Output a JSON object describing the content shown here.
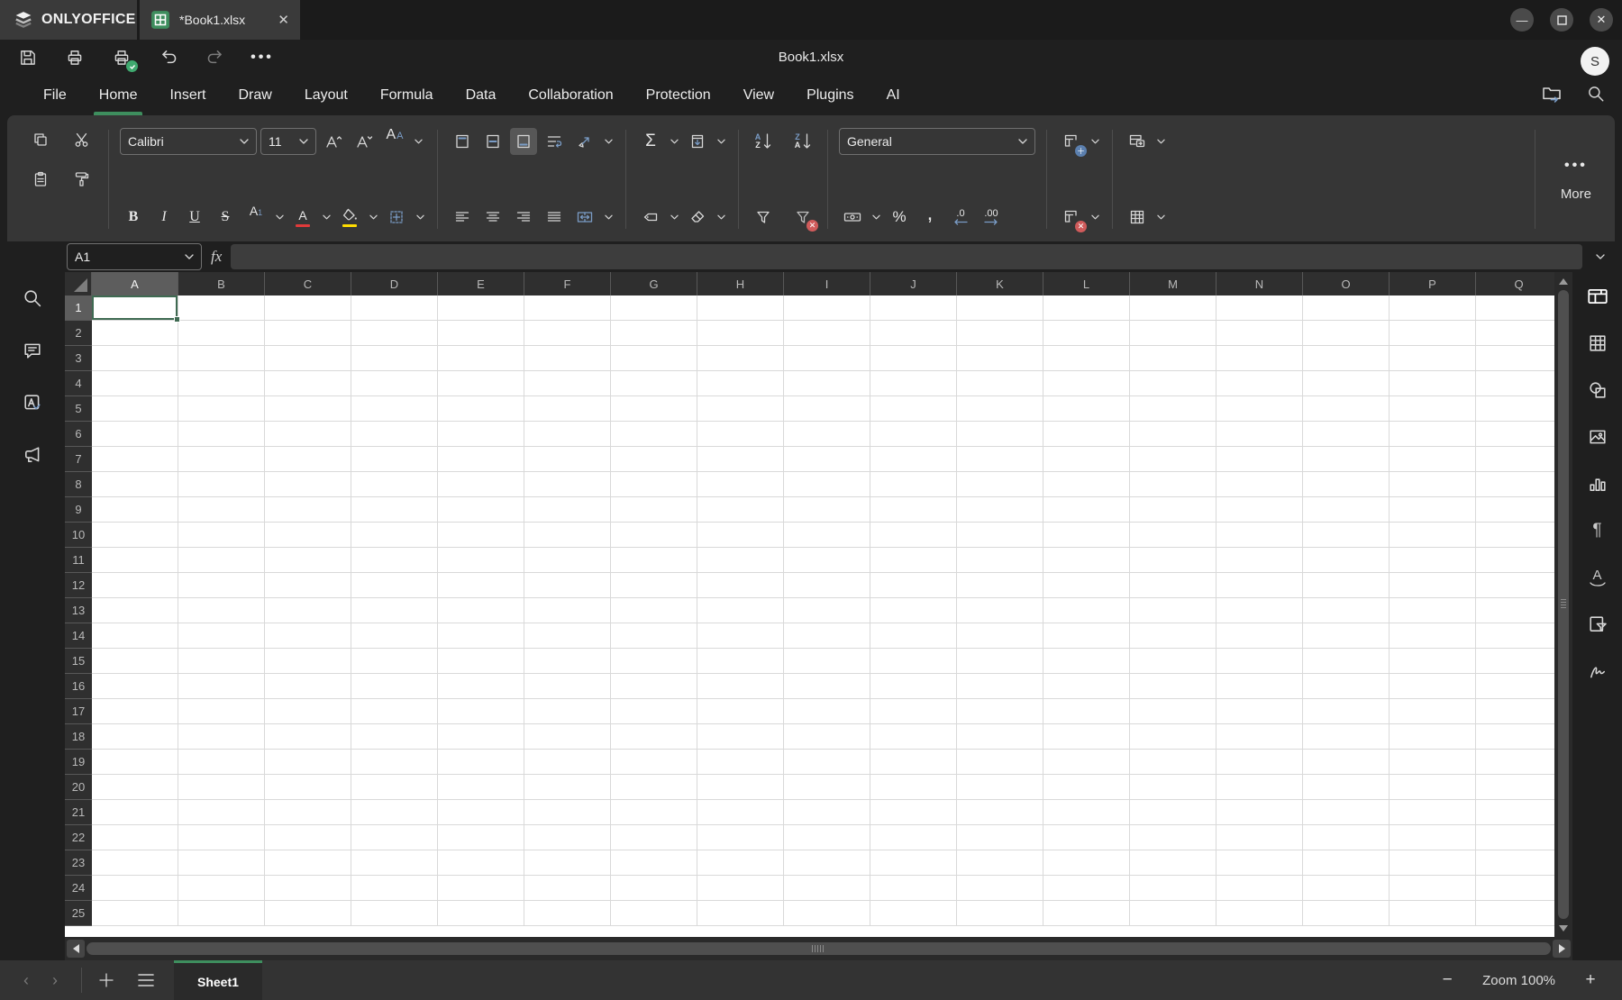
{
  "titlebar": {
    "brand": "ONLYOFFICE",
    "doc_tab_title": "*Book1.xlsx"
  },
  "header": {
    "doc_title": "Book1.xlsx",
    "user_initial": "S"
  },
  "menu": {
    "tabs": [
      "File",
      "Home",
      "Insert",
      "Draw",
      "Layout",
      "Formula",
      "Data",
      "Collaboration",
      "Protection",
      "View",
      "Plugins",
      "AI"
    ],
    "active_tab": "Home"
  },
  "toolbar": {
    "font_name": "Calibri",
    "font_size": "11",
    "number_format": "General",
    "more_label": "More",
    "glyphs": {
      "bold": "B",
      "italic": "I",
      "underline": "U",
      "strikethrough": "S",
      "sum": "Σ",
      "percent": "%",
      "comma": ",",
      "sort_a": "A",
      "sort_z": "Z",
      "dec_decimal": ".0",
      "inc_decimal": ".00",
      "case_large": "A",
      "case_small": "A",
      "script_a": "A",
      "script_1": "1",
      "font_color_a": "A"
    }
  },
  "formula_bar": {
    "cell_ref": "A1",
    "fx_label": "fx",
    "input_value": ""
  },
  "grid": {
    "columns": [
      "A",
      "B",
      "C",
      "D",
      "E",
      "F",
      "G",
      "H",
      "I",
      "J",
      "K",
      "L",
      "M",
      "N",
      "O",
      "P",
      "Q"
    ],
    "row_count": 25,
    "selected_cell": "A1",
    "selected_column": "A",
    "selected_row": 1
  },
  "status_bar": {
    "sheets": [
      {
        "name": "Sheet1",
        "active": true
      }
    ],
    "zoom_label": "Zoom 100%"
  },
  "side_rails": {
    "paragraph_glyph": "¶",
    "textart_glyph": "A",
    "spellcheck_glyph": "A"
  },
  "colors": {
    "accent_green": "#3E8E5E",
    "selection_border": "#3F6A52",
    "font_color_red": "#E03A3A",
    "highlight_yellow": "#FFDD00",
    "icon_blue": "#7A9CC6",
    "badge_green": "#3FA96F",
    "badge_red": "#D05B5B"
  }
}
